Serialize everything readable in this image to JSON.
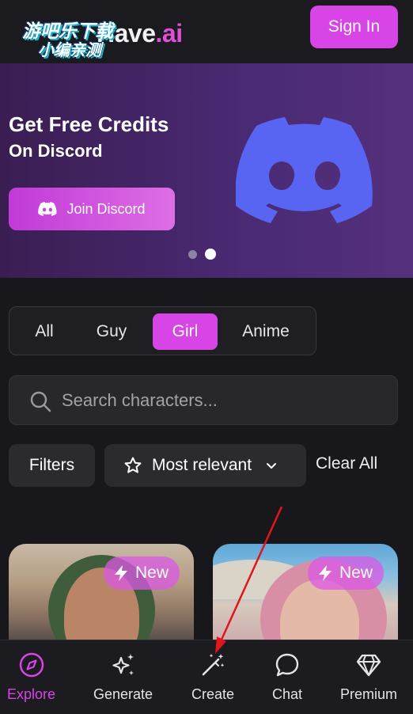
{
  "header": {
    "logo_text": "Have",
    "logo_suffix": ".ai",
    "watermark_line1": "游吧乐下载",
    "watermark_line2": "小编亲测",
    "signin_label": "Sign In"
  },
  "banner": {
    "title": "Get Free Credits",
    "subtitle": "On Discord",
    "button_label": "Join Discord",
    "slides": 2,
    "active_slide": 2
  },
  "tabs": [
    {
      "label": "All",
      "active": false
    },
    {
      "label": "Guy",
      "active": false
    },
    {
      "label": "Girl",
      "active": true
    },
    {
      "label": "Anime",
      "active": false
    }
  ],
  "search": {
    "placeholder": "Search characters..."
  },
  "filters": {
    "filters_label": "Filters",
    "sort_label": "Most relevant",
    "clear_label": "Clear All"
  },
  "cards": [
    {
      "badge": "New"
    },
    {
      "badge": "New"
    }
  ],
  "nav": [
    {
      "label": "Explore",
      "icon": "compass-icon",
      "active": true
    },
    {
      "label": "Generate",
      "icon": "sparkles-icon",
      "active": false
    },
    {
      "label": "Create",
      "icon": "magic-wand-icon",
      "active": false
    },
    {
      "label": "Chat",
      "icon": "chat-bubble-icon",
      "active": false
    },
    {
      "label": "Premium",
      "icon": "diamond-icon",
      "active": false
    }
  ],
  "colors": {
    "accent": "#d745e6",
    "background": "#18171b",
    "discord": "#5865f2",
    "annotation_arrow": "#e0161b"
  }
}
